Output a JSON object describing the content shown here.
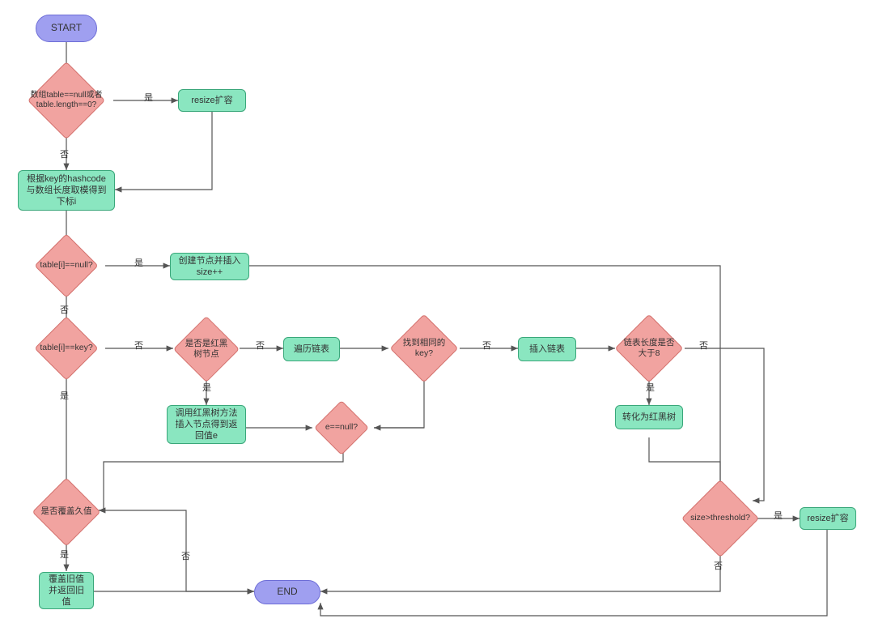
{
  "nodes": {
    "start": "START",
    "end": "END",
    "d_table_null": "数组table==null或者table.length==0?",
    "p_resize1": "resize扩容",
    "p_hashcode": "根据key的hashcode与数组长度取模得到下标i",
    "d_slot_null": "table[i]==null?",
    "p_create_insert": "创建节点并插入 size++",
    "d_slot_key": "table[i]==key?",
    "d_is_rbtree": "是否是红黑树节点",
    "p_traverse_list": "遍历链表",
    "d_found_key": "找到相同的key?",
    "p_insert_list": "插入链表",
    "d_list_gt8": "链表长度是否大于8",
    "p_to_rbtree": "转化为红黑树",
    "p_rbtree_insert": "调用红黑树方法插入节点得到返回值e",
    "d_e_null": "e==null?",
    "d_override": "是否覆盖久值",
    "p_override_old": "覆盖旧值并返回旧值",
    "d_size_threshold": "size>threshold?",
    "p_resize2": "resize扩容"
  },
  "labels": {
    "yes": "是",
    "no": "否"
  },
  "chart_data": {
    "type": "flowchart",
    "title": "HashMap put 流程",
    "nodes": [
      {
        "id": "start",
        "type": "terminal",
        "label": "START"
      },
      {
        "id": "d_table_null",
        "type": "decision",
        "label": "数组table==null或者table.length==0?"
      },
      {
        "id": "p_resize1",
        "type": "process",
        "label": "resize扩容"
      },
      {
        "id": "p_hashcode",
        "type": "process",
        "label": "根据key的hashcode与数组长度取模得到下标i"
      },
      {
        "id": "d_slot_null",
        "type": "decision",
        "label": "table[i]==null?"
      },
      {
        "id": "p_create_insert",
        "type": "process",
        "label": "创建节点并插入 size++"
      },
      {
        "id": "d_slot_key",
        "type": "decision",
        "label": "table[i]==key?"
      },
      {
        "id": "d_is_rbtree",
        "type": "decision",
        "label": "是否是红黑树节点"
      },
      {
        "id": "p_traverse_list",
        "type": "process",
        "label": "遍历链表"
      },
      {
        "id": "d_found_key",
        "type": "decision",
        "label": "找到相同的key?"
      },
      {
        "id": "p_insert_list",
        "type": "process",
        "label": "插入链表"
      },
      {
        "id": "d_list_gt8",
        "type": "decision",
        "label": "链表长度是否大于8"
      },
      {
        "id": "p_to_rbtree",
        "type": "process",
        "label": "转化为红黑树"
      },
      {
        "id": "p_rbtree_insert",
        "type": "process",
        "label": "调用红黑树方法插入节点得到返回值e"
      },
      {
        "id": "d_e_null",
        "type": "decision",
        "label": "e==null?"
      },
      {
        "id": "d_override",
        "type": "decision",
        "label": "是否覆盖久值"
      },
      {
        "id": "p_override_old",
        "type": "process",
        "label": "覆盖旧值并返回旧值"
      },
      {
        "id": "d_size_threshold",
        "type": "decision",
        "label": "size>threshold?"
      },
      {
        "id": "p_resize2",
        "type": "process",
        "label": "resize扩容"
      },
      {
        "id": "end",
        "type": "terminal",
        "label": "END"
      }
    ],
    "edges": [
      {
        "from": "start",
        "to": "d_table_null"
      },
      {
        "from": "d_table_null",
        "to": "p_resize1",
        "label": "是"
      },
      {
        "from": "d_table_null",
        "to": "p_hashcode",
        "label": "否"
      },
      {
        "from": "p_resize1",
        "to": "p_hashcode"
      },
      {
        "from": "p_hashcode",
        "to": "d_slot_null"
      },
      {
        "from": "d_slot_null",
        "to": "p_create_insert",
        "label": "是"
      },
      {
        "from": "d_slot_null",
        "to": "d_slot_key",
        "label": "否"
      },
      {
        "from": "p_create_insert",
        "to": "d_size_threshold"
      },
      {
        "from": "d_slot_key",
        "to": "d_is_rbtree",
        "label": "否"
      },
      {
        "from": "d_slot_key",
        "to": "d_override",
        "label": "是"
      },
      {
        "from": "d_is_rbtree",
        "to": "p_rbtree_insert",
        "label": "是"
      },
      {
        "from": "d_is_rbtree",
        "to": "p_traverse_list",
        "label": "否"
      },
      {
        "from": "p_traverse_list",
        "to": "d_found_key"
      },
      {
        "from": "d_found_key",
        "to": "p_insert_list",
        "label": "否"
      },
      {
        "from": "d_found_key",
        "to": "d_e_null",
        "label": "是"
      },
      {
        "from": "p_insert_list",
        "to": "d_list_gt8"
      },
      {
        "from": "d_list_gt8",
        "to": "p_to_rbtree",
        "label": "是"
      },
      {
        "from": "d_list_gt8",
        "to": "d_size_threshold",
        "label": "否"
      },
      {
        "from": "p_to_rbtree",
        "to": "d_size_threshold"
      },
      {
        "from": "p_rbtree_insert",
        "to": "d_e_null"
      },
      {
        "from": "d_e_null",
        "to": "d_override",
        "label": "否"
      },
      {
        "from": "d_e_null",
        "to": "d_size_threshold",
        "label": "是"
      },
      {
        "from": "d_override",
        "to": "p_override_old",
        "label": "是"
      },
      {
        "from": "d_override",
        "to": "end",
        "label": "否"
      },
      {
        "from": "p_override_old",
        "to": "end"
      },
      {
        "from": "d_size_threshold",
        "to": "p_resize2",
        "label": "是"
      },
      {
        "from": "d_size_threshold",
        "to": "end",
        "label": "否"
      },
      {
        "from": "p_resize2",
        "to": "end"
      }
    ]
  }
}
